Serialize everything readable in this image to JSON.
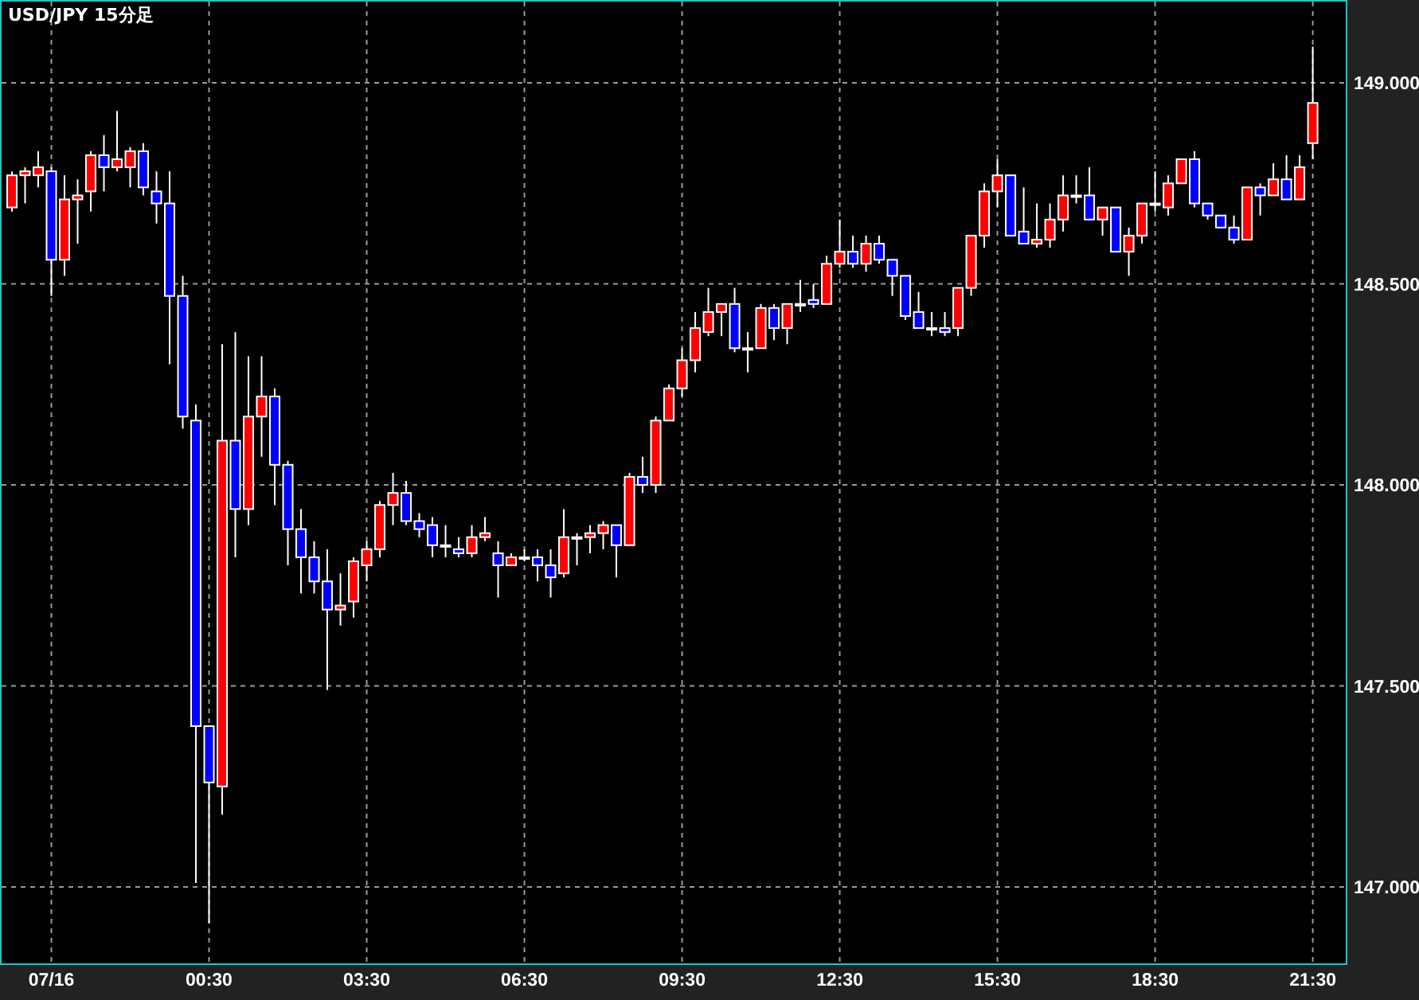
{
  "chart_data": {
    "type": "candlestick",
    "title": "USD/JPY 15分足",
    "grid": true,
    "categories": [
      null,
      null,
      null,
      "07/16",
      null,
      null,
      null,
      null,
      null,
      null,
      null,
      null,
      null,
      null,
      null,
      "00:30",
      null,
      null,
      null,
      null,
      null,
      null,
      null,
      null,
      null,
      null,
      null,
      "03:30",
      null,
      null,
      null,
      null,
      null,
      null,
      null,
      null,
      null,
      null,
      null,
      "06:30",
      null,
      null,
      null,
      null,
      null,
      null,
      null,
      null,
      null,
      null,
      null,
      "09:30",
      null,
      null,
      null,
      null,
      null,
      null,
      null,
      null,
      null,
      null,
      null,
      "12:30",
      null,
      null,
      null,
      null,
      null,
      null,
      null,
      null,
      null,
      null,
      null,
      "15:30",
      null,
      null,
      null,
      null,
      null,
      null,
      null,
      null,
      null,
      null,
      null,
      "18:30",
      null,
      null,
      null,
      null,
      null,
      null,
      null,
      null,
      null,
      null,
      null,
      "21:30"
    ],
    "ohlc": [
      [
        148.69,
        148.78,
        148.68,
        148.77
      ],
      [
        148.77,
        148.79,
        148.7,
        148.78
      ],
      [
        148.77,
        148.83,
        148.74,
        148.79
      ],
      [
        148.78,
        148.79,
        148.47,
        148.56
      ],
      [
        148.56,
        148.77,
        148.52,
        148.71
      ],
      [
        148.71,
        148.76,
        148.6,
        148.72
      ],
      [
        148.73,
        148.83,
        148.68,
        148.82
      ],
      [
        148.82,
        148.87,
        148.73,
        148.79
      ],
      [
        148.79,
        148.93,
        148.78,
        148.81
      ],
      [
        148.79,
        148.84,
        148.74,
        148.83
      ],
      [
        148.83,
        148.85,
        148.72,
        148.74
      ],
      [
        148.73,
        148.78,
        148.65,
        148.7
      ],
      [
        148.7,
        148.78,
        148.3,
        148.47
      ],
      [
        148.47,
        148.52,
        148.14,
        148.17
      ],
      [
        148.16,
        148.2,
        147.01,
        147.4
      ],
      [
        147.4,
        147.4,
        146.91,
        147.26
      ],
      [
        147.25,
        148.35,
        147.18,
        148.11
      ],
      [
        148.11,
        148.38,
        147.82,
        147.94
      ],
      [
        147.94,
        148.32,
        147.9,
        148.17
      ],
      [
        148.17,
        148.32,
        148.07,
        148.22
      ],
      [
        148.22,
        148.24,
        147.95,
        148.05
      ],
      [
        148.05,
        148.06,
        147.8,
        147.89
      ],
      [
        147.89,
        147.94,
        147.73,
        147.82
      ],
      [
        147.82,
        147.86,
        147.73,
        147.76
      ],
      [
        147.76,
        147.84,
        147.49,
        147.69
      ],
      [
        147.69,
        147.78,
        147.65,
        147.7
      ],
      [
        147.71,
        147.82,
        147.67,
        147.81
      ],
      [
        147.8,
        147.86,
        147.76,
        147.84
      ],
      [
        147.84,
        147.96,
        147.82,
        147.95
      ],
      [
        147.95,
        148.03,
        147.9,
        147.98
      ],
      [
        147.98,
        148.01,
        147.9,
        147.91
      ],
      [
        147.91,
        147.93,
        147.87,
        147.89
      ],
      [
        147.9,
        147.92,
        147.82,
        147.85
      ],
      [
        147.85,
        147.9,
        147.82,
        147.85
      ],
      [
        147.84,
        147.87,
        147.82,
        147.83
      ],
      [
        147.83,
        147.9,
        147.82,
        147.87
      ],
      [
        147.87,
        147.92,
        147.86,
        147.88
      ],
      [
        147.83,
        147.86,
        147.72,
        147.8
      ],
      [
        147.8,
        147.83,
        147.8,
        147.82
      ],
      [
        147.82,
        147.84,
        147.81,
        147.82
      ],
      [
        147.82,
        147.84,
        147.76,
        147.8
      ],
      [
        147.8,
        147.84,
        147.72,
        147.77
      ],
      [
        147.78,
        147.94,
        147.77,
        147.87
      ],
      [
        147.87,
        147.88,
        147.8,
        147.87
      ],
      [
        147.87,
        147.9,
        147.83,
        147.88
      ],
      [
        147.88,
        147.91,
        147.84,
        147.9
      ],
      [
        147.9,
        147.9,
        147.77,
        147.85
      ],
      [
        147.85,
        148.03,
        147.85,
        148.02
      ],
      [
        148.02,
        148.07,
        147.98,
        148.0
      ],
      [
        148.0,
        148.17,
        147.98,
        148.16
      ],
      [
        148.16,
        148.25,
        148.16,
        148.24
      ],
      [
        148.24,
        148.34,
        148.22,
        148.31
      ],
      [
        148.31,
        148.43,
        148.28,
        148.39
      ],
      [
        148.38,
        148.49,
        148.37,
        148.43
      ],
      [
        148.43,
        148.45,
        148.37,
        148.45
      ],
      [
        148.45,
        148.49,
        148.33,
        148.34
      ],
      [
        148.34,
        148.38,
        148.28,
        148.34
      ],
      [
        148.34,
        148.45,
        148.34,
        148.44
      ],
      [
        148.44,
        148.45,
        148.36,
        148.39
      ],
      [
        148.39,
        148.45,
        148.35,
        148.45
      ],
      [
        148.45,
        148.51,
        148.43,
        148.45
      ],
      [
        148.46,
        148.5,
        148.44,
        148.45
      ],
      [
        148.45,
        148.57,
        148.45,
        148.55
      ],
      [
        148.55,
        148.66,
        148.54,
        148.58
      ],
      [
        148.58,
        148.62,
        148.54,
        148.55
      ],
      [
        148.55,
        148.62,
        148.53,
        148.6
      ],
      [
        148.6,
        148.62,
        148.55,
        148.56
      ],
      [
        148.56,
        148.56,
        148.47,
        148.52
      ],
      [
        148.52,
        148.52,
        148.41,
        148.42
      ],
      [
        148.43,
        148.48,
        148.39,
        148.39
      ],
      [
        148.39,
        148.43,
        148.37,
        148.39
      ],
      [
        148.39,
        148.43,
        148.37,
        148.38
      ],
      [
        148.39,
        148.49,
        148.37,
        148.49
      ],
      [
        148.49,
        148.62,
        148.47,
        148.62
      ],
      [
        148.62,
        148.75,
        148.59,
        148.73
      ],
      [
        148.73,
        148.81,
        148.69,
        148.77
      ],
      [
        148.77,
        148.77,
        148.62,
        148.62
      ],
      [
        148.63,
        148.74,
        148.6,
        148.6
      ],
      [
        148.6,
        148.7,
        148.59,
        148.61
      ],
      [
        148.61,
        148.7,
        148.59,
        148.66
      ],
      [
        148.66,
        148.77,
        148.63,
        148.72
      ],
      [
        148.72,
        148.77,
        148.7,
        148.72
      ],
      [
        148.72,
        148.79,
        148.66,
        148.66
      ],
      [
        148.66,
        148.69,
        148.62,
        148.69
      ],
      [
        148.69,
        148.69,
        148.58,
        148.58
      ],
      [
        148.58,
        148.64,
        148.52,
        148.62
      ],
      [
        148.62,
        148.7,
        148.6,
        148.7
      ],
      [
        148.7,
        148.78,
        148.68,
        148.7
      ],
      [
        148.69,
        148.77,
        148.67,
        148.75
      ],
      [
        148.75,
        148.81,
        148.75,
        148.81
      ],
      [
        148.81,
        148.83,
        148.69,
        148.7
      ],
      [
        148.7,
        148.7,
        148.66,
        148.67
      ],
      [
        148.67,
        148.67,
        148.64,
        148.64
      ],
      [
        148.64,
        148.67,
        148.6,
        148.61
      ],
      [
        148.61,
        148.74,
        148.61,
        148.74
      ],
      [
        148.74,
        148.75,
        148.67,
        148.72
      ],
      [
        148.72,
        148.8,
        148.72,
        148.76
      ],
      [
        148.76,
        148.82,
        148.71,
        148.71
      ],
      [
        148.71,
        148.82,
        148.71,
        148.79
      ],
      [
        148.85,
        149.09,
        148.81,
        148.95
      ]
    ],
    "ylim": [
      146.81,
      149.206
    ],
    "yticks": [
      {
        "value": 147,
        "label": "147.000"
      },
      {
        "value": 147.5,
        "label": "147.500"
      },
      {
        "value": 148,
        "label": "148.000"
      },
      {
        "value": 148.5,
        "label": "148.500"
      },
      {
        "value": 149,
        "label": "149.000"
      }
    ]
  }
}
